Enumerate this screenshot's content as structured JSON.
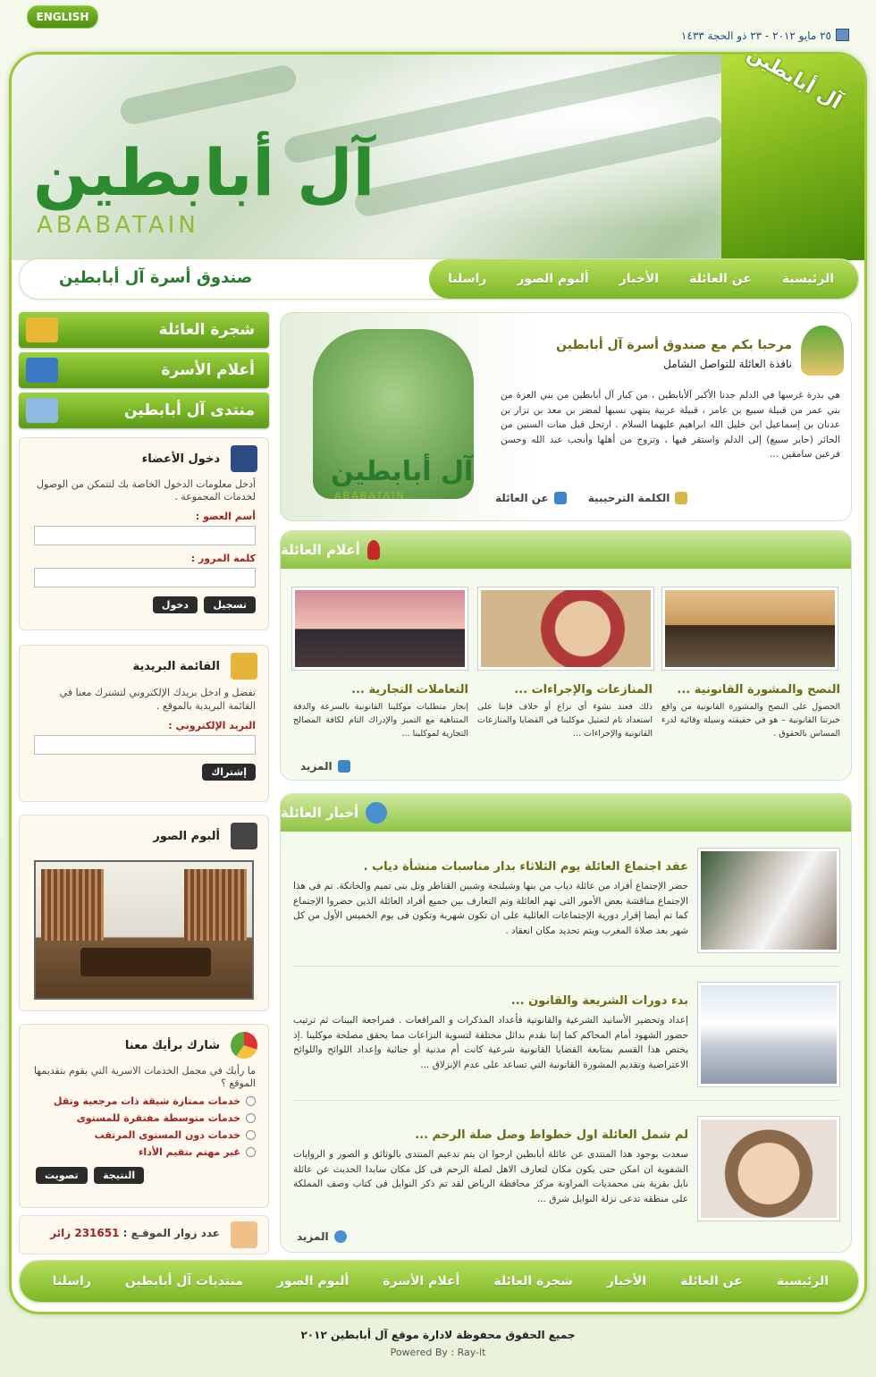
{
  "top": {
    "english_label": "ENGLISH",
    "date": "٢٥ مايو ٢٠١٢ - ٢٣ ذو الحجة ١٤٣٣"
  },
  "banner": {
    "logo_ar": "آل أبابطين",
    "logo_en": "ABABATAIN",
    "corner_logo": "آل أبابطين"
  },
  "header_nav": {
    "fund_title": "صندوق أسرة آل أبابطين",
    "items": [
      "الرئيسية",
      "عن العائلة",
      "الأخبار",
      "ألبوم الصور",
      "راسلنا"
    ]
  },
  "side_tabs": [
    "شجرة العائلة",
    "أعلام الأسرة",
    "منتدى آل أبابطين"
  ],
  "login": {
    "title": "دخول الأعضاء",
    "intro": "أدخل معلومات الدخول الخاصة بك لتتمكن من الوصول لخدمات المجموعة .",
    "user_label": "أسم العضو :",
    "pass_label": "كلمة المرور :",
    "login_btn": "دخول",
    "register_btn": "تسجيل"
  },
  "mailing": {
    "title": "القائمة البريدية",
    "intro": "تفضل و ادخل بريدك الإلكتروني لتشترك معنا في القائمة البريدية بالموقع .",
    "email_label": "البريد الإلكتروني :",
    "subscribe_btn": "إشتراك"
  },
  "album": {
    "title": "ألبوم الصور"
  },
  "poll": {
    "title": "شارك برأيك معنا",
    "question": "ما رأيك في مجمل الخدمات الاسرية التي يقوم بتقديمها الموقع ؟",
    "options": [
      "خدمات ممتازة شيقة ذات مرجعية وتقل",
      "خدمات متوسطة مفتقرة للمستوى",
      "خدمات دون المستوى المرتقب",
      "غير مهتم بتقيم الأداء"
    ],
    "vote_btn": "تصويت",
    "result_btn": "النتيجة"
  },
  "visitors": {
    "label": "عدد زوار الموقـع :",
    "count": "231651",
    "unit": "زائر"
  },
  "welcome": {
    "title": "مرحبا بكم مع صندوق أسرة آل أبابطين",
    "subtitle": "نافذة العائلة للتواصل الشامل",
    "text": "هي بذرة غرسها في الدلم جدنا الأكبر آلأبابطين ، من كبار آل أبابطين من بني العزة من بني عمر من قبيلة سبيع بن عامر ، قبيلة عربية ينتهي نسبها لمضر بن معد بن نزار بن عدنان بن إسماعيل ابن خليل الله ابراهيم عليهما السلام . ارتحل قبل منات السنين من الحائر (حاير سبيع) إلى الدلم واستقر فيها ، وتزوج من أهلها وأنجب عبد الله وحسن فرعين سامقين ...",
    "link_welcome": "الكلمة الترحيبية",
    "link_about": "عن العائلة",
    "logo_ar": "آل أبابطين",
    "logo_en": "ABABATAIN"
  },
  "notables": {
    "title": "أعلام العائلة",
    "items": [
      {
        "title": "النصح والمشورة القانونية ...",
        "text": "الحصول على النصح والمشورة القانونية من واقع خبرتنا القانونية – هو في حقيقته وسيلة وقائية لدرء المساس بالحقوق ."
      },
      {
        "title": "المنازعات والإجراءات ...",
        "text": "ذلك فعند نشوء أي نزاع أو خلاف فإننا على استعداد تام لتمثيل موكلينا في القضايا والمنازعات القانونية والإجراءات ..."
      },
      {
        "title": "التعاملات التجارية ...",
        "text": "إنجاز متطلبات موكلينا القانونية بالسرعة والدقة المتناهية مع التميز والإدراك التام لكافة المصالح التجارية لموكلينا ..."
      }
    ],
    "more": "المزيد"
  },
  "news": {
    "title": "أخبار العائلة",
    "items": [
      {
        "title": "عقد اجتماع العائلة يوم الثلاثاء بدار مناسبات منشأة دياب .",
        "text": "حضر الإجتماع أفراد من عائلة دياب من بنها وشبلنجة وشبين القناطر وتل بنى تميم والخانكة. تم فى هذا الإجتماع مناقشة بعض الأمور التى تهم العائلة وتم التعارف بين جميع أفراد العائلة الذين حضروا الإجتماع كما تم أيضا إقرار دورية الإجتماعات العائلية على ان تكون شهرية وتكون فى يوم الخميس الأول من كل شهر بعد صلاة المغرب ويتم تحديد مكان انعقاد ."
      },
      {
        "title": "بدء دورات الشريعة والقانون ...",
        "text": "إعداد وتحضير الأسانيد الشرعية والقانونية فأعداد المذكرات و المرافعات . فمراجعة البينات ثم ترتيب حضور الشهود أمام المحاكم كما إننا نقدم بدائل مختلفة لتسوية النزاعات مما يحقق مصلحة موكلينا .إذ يختص هذا القسم بمتابعة القضايا القانونية شرعية كانت أم مدنية أو جنائية وإعداد اللوائح واللوائح الاعتراضية وتقديم المشورة القانونية التي تساعد على عدم الإنزلاق ..."
      },
      {
        "title": "لم شمل العائلة اول خطواط وصل صلة الرحم ...",
        "text": "سعدت بوجود هذا المنتدى عن عائلة أبابطين ارجوا ان يتم تدعيم المنتدى بالوثائق و الصور و الروايات الشفوية ان امكن حتى يكون مكان لتعارف الاهل لصلة الرحم فى كل مكان سابدا الحديث عن عائلة نايل بقرية بنى محمديات المراونة مركز محافظة الرياض لقد تم ذكر النوايل فى كتاب وصف المملكة على منطقه تدعى نزلة النوايل شرق ..."
      }
    ],
    "more": "المزيد"
  },
  "footer_nav": {
    "items": [
      "الرئيسية",
      "عن العائلة",
      "الأخبار",
      "شجرة العائلة",
      "أعلام الأسرة",
      "ألبوم الصور",
      "منتديات آل أبابطين",
      "راسلنا"
    ]
  },
  "footer": {
    "copyright": "جميع الحقوق محفوظة لادارة موقع آل أبابطين ٢٠١٢",
    "powered": "Powered By : Ray-it"
  },
  "colors": {
    "brand_green": "#7cb726",
    "dark_green": "#2a7a2d",
    "accent_red": "#a32222"
  }
}
